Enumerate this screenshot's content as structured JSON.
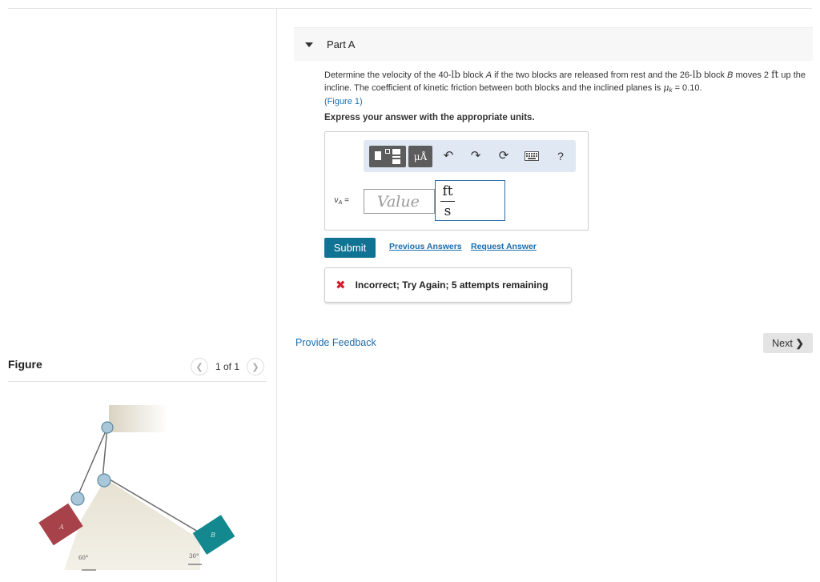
{
  "part": {
    "title": "Part A"
  },
  "problem": {
    "seg1": "Determine the velocity of the 40-",
    "unit1": "lb",
    "seg2": " block ",
    "blockA": "A",
    "seg3": " if the two blocks are released from rest and the 26-",
    "unit2": "lb",
    "seg4": " block ",
    "blockB": "B",
    "seg5": " moves 2 ",
    "unit3": "ft",
    "seg6": " up the incline. The coefficient of kinetic friction between both blocks and the inclined planes is ",
    "mu": "μ",
    "mu_sub": "k",
    "seg7": " = 0.10.",
    "figure_link": "(Figure 1)"
  },
  "express": "Express your answer with the appropriate units.",
  "toolbar": {
    "mu_label": "μÅ",
    "undo_icon": "undo-icon",
    "redo_icon": "redo-icon",
    "reset_icon": "reset-icon",
    "keyboard_icon": "keyboard-icon",
    "help_label": "?"
  },
  "answer": {
    "var": "v",
    "var_sub": "A",
    "equals": " =",
    "placeholder": "Value",
    "value": "",
    "unit_num": "ft",
    "unit_den": "s"
  },
  "actions": {
    "submit": "Submit",
    "previous": "Previous Answers",
    "request": "Request Answer"
  },
  "feedback": {
    "icon": "x-icon",
    "text": "Incorrect; Try Again; 5 attempts remaining"
  },
  "provide_feedback": "Provide Feedback",
  "next": "Next",
  "figure": {
    "title": "Figure",
    "pager": "1 of 1",
    "label_a": "A",
    "label_b": "B",
    "angle_a": "60°",
    "angle_b": "30°"
  },
  "colors": {
    "accent": "#0f7394",
    "link": "#1b6dae",
    "error": "#d2202f",
    "block_a": "#a8424a",
    "block_b": "#13888f",
    "incline": "#e3ddcc"
  }
}
